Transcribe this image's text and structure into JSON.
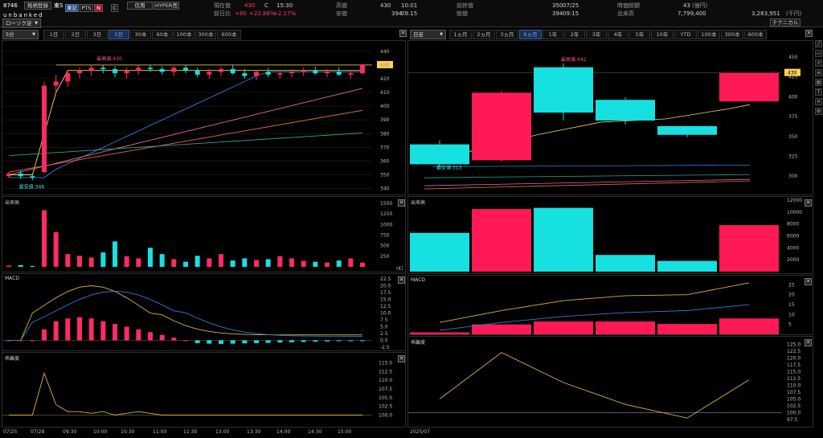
{
  "header": {
    "code": "8746",
    "market": "東S",
    "name": "unbanked",
    "watch_label": "銘柄登録",
    "btn_tse": "東証",
    "btn_pts": "PTS",
    "btn_n": "N",
    "btn_c": "C",
    "btn_credit": "信用",
    "btn_hyper": "HYPER売",
    "cur_label": "現在値",
    "cur_val": "430",
    "cur_flag": "C",
    "cur_time": "15:30",
    "prev_label": "前日比",
    "prev_val": "+80",
    "prev_pct": "+22.86%",
    "prev_pct2": "+2.17%",
    "high_label": "高値",
    "high_val": "430",
    "high_time": "10:01",
    "low_label": "安値",
    "low_val": "394",
    "low_time": "09:15",
    "prevclose_label": "前終値",
    "prevclose_val": "350",
    "prevclose_date": "07/25",
    "open_label": "始値",
    "open_val": "394",
    "open_time": "09:15",
    "mcap_label": "時価総額",
    "mcap_val": "43",
    "mcap_unit": "(億円)",
    "volume_label": "出来高",
    "volume_val": "7,799,400",
    "turnover_val": "3,283,951",
    "turnover_unit": "(千円)",
    "tech_btn": "テクニカル"
  },
  "left_toolbar": {
    "chart_type": "ローソク足",
    "interval": "5分",
    "ranges": [
      "1日",
      "2日",
      "3日",
      "5日",
      "30本",
      "60本",
      "100本",
      "300本",
      "600本"
    ],
    "active": "5日"
  },
  "right_toolbar": {
    "interval": "日足",
    "ranges": [
      "1ヵ月",
      "2ヵ月",
      "3ヵ月",
      "6ヵ月",
      "1年",
      "2年",
      "3年",
      "4年",
      "5年",
      "10年",
      "YTD",
      "100本",
      "300本",
      "600本"
    ],
    "active": "6ヵ月"
  },
  "left_chart": {
    "price_axis": [
      "440",
      "430",
      "420",
      "410",
      "400",
      "390",
      "380",
      "370",
      "360",
      "350",
      "340"
    ],
    "price_tag": "430",
    "high_annot": "最高値:430",
    "low_annot": "最安値:346",
    "volume_label": "出来高",
    "volume_axis": [
      "1500",
      "1250",
      "1000",
      "750",
      "500",
      "250"
    ],
    "volume_unit": "(K)",
    "macd_label": "MACD",
    "macd_axis": [
      "22.5",
      "20.0",
      "17.5",
      "15.0",
      "12.5",
      "10.0",
      "7.5",
      "5.0",
      "2.5",
      "0.0",
      "-2.5"
    ],
    "ratio_label": "乖離度",
    "ratio_axis": [
      "115.0",
      "112.5",
      "110.0",
      "107.5",
      "105.0",
      "102.5",
      "100.0"
    ],
    "time_axis": [
      "07/25",
      "07/28",
      "09:30",
      "10:00",
      "10:30",
      "11:00",
      "11:30",
      "13:00",
      "13:30",
      "14:00",
      "14:30",
      "15:00"
    ]
  },
  "right_chart": {
    "price_axis": [
      "450",
      "425",
      "400",
      "375",
      "350",
      "325",
      "300"
    ],
    "price_tag": "430",
    "high_annot": "最高値:442",
    "low_annot": "最安値:313",
    "volume_label": "出来高",
    "volume_axis": [
      "12000",
      "10000",
      "8000",
      "6000",
      "4000",
      "2000"
    ],
    "macd_label": "MACD",
    "macd_axis": [
      "25",
      "20",
      "15",
      "10",
      "5"
    ],
    "ratio_label": "乖離度",
    "ratio_axis": [
      "125.0",
      "122.5",
      "120.0",
      "117.5",
      "115.0",
      "112.5",
      "110.0",
      "107.5",
      "105.0",
      "102.5",
      "100.0",
      "97.5"
    ],
    "time_axis": [
      "2025/07"
    ]
  },
  "chart_data": [
    {
      "type": "candlestick",
      "title": "",
      "interval": "5分",
      "ylim": [
        338,
        444
      ],
      "ohlc": [
        [
          349,
          352,
          348,
          351
        ],
        [
          351,
          353,
          347,
          349
        ],
        [
          349,
          350,
          346,
          348
        ],
        [
          352,
          418,
          351,
          415
        ],
        [
          415,
          423,
          410,
          418
        ],
        [
          418,
          426,
          414,
          424
        ],
        [
          424,
          428,
          420,
          426
        ],
        [
          426,
          430,
          422,
          428
        ],
        [
          428,
          430,
          424,
          427
        ],
        [
          427,
          429,
          421,
          424
        ],
        [
          424,
          428,
          420,
          426
        ],
        [
          426,
          430,
          423,
          428
        ],
        [
          428,
          430,
          425,
          427
        ],
        [
          427,
          429,
          423,
          425
        ],
        [
          425,
          429,
          422,
          428
        ],
        [
          428,
          430,
          424,
          426
        ],
        [
          426,
          428,
          421,
          423
        ],
        [
          423,
          427,
          420,
          425
        ],
        [
          425,
          429,
          422,
          427
        ],
        [
          427,
          430,
          423,
          424
        ],
        [
          424,
          427,
          420,
          422
        ],
        [
          422,
          426,
          419,
          425
        ],
        [
          425,
          428,
          421,
          423
        ],
        [
          423,
          426,
          420,
          424
        ],
        [
          424,
          427,
          421,
          425
        ],
        [
          425,
          428,
          422,
          426
        ],
        [
          426,
          429,
          423,
          424
        ],
        [
          424,
          427,
          421,
          425
        ],
        [
          425,
          428,
          422,
          423
        ],
        [
          423,
          426,
          420,
          424
        ],
        [
          424,
          431,
          423,
          430
        ]
      ],
      "volume_k": [
        30,
        40,
        20,
        1340,
        820,
        300,
        260,
        220,
        340,
        600,
        250,
        200,
        450,
        300,
        180,
        120,
        260,
        200,
        300,
        150,
        200,
        160,
        180,
        250,
        200,
        140,
        120,
        100,
        150,
        200,
        100
      ],
      "macd_hist": [
        0,
        0,
        0,
        4,
        7,
        8,
        8.5,
        8,
        7,
        6,
        5,
        4,
        3,
        2,
        1,
        0,
        -1,
        -1.2,
        -1.3,
        -1.2,
        -1.1,
        -1,
        -0.9,
        -0.8,
        -0.7,
        -0.6,
        -0.5,
        -0.4,
        -0.3,
        -0.3,
        -0.2
      ],
      "ratio": [
        100,
        100,
        100,
        112,
        103,
        101,
        101,
        100.5,
        101,
        100,
        100.5,
        101,
        100.5,
        100,
        100,
        100,
        100,
        100,
        100,
        100,
        100,
        100,
        100,
        100,
        100,
        100,
        100,
        100,
        100,
        100,
        100
      ]
    },
    {
      "type": "candlestick",
      "title": "",
      "interval": "日足",
      "ylim": [
        280,
        465
      ],
      "ohlc": [
        [
          315,
          345,
          313,
          340
        ],
        [
          405,
          408,
          318,
          320
        ],
        [
          380,
          442,
          370,
          437
        ],
        [
          370,
          399,
          365,
          396
        ],
        [
          352,
          360,
          349,
          363
        ],
        [
          430,
          430,
          394,
          394
        ]
      ],
      "volume": [
        6500,
        10500,
        10700,
        2800,
        1800,
        7800
      ],
      "macd_hist": [
        1,
        5,
        6.5,
        6.5,
        5.2,
        8
      ],
      "macd_line": [
        6,
        12,
        17,
        19.5,
        20,
        26
      ],
      "signal_line": [
        2,
        6,
        9,
        11,
        12,
        15
      ],
      "ratio": [
        105,
        122,
        111,
        103,
        98,
        112
      ]
    }
  ]
}
